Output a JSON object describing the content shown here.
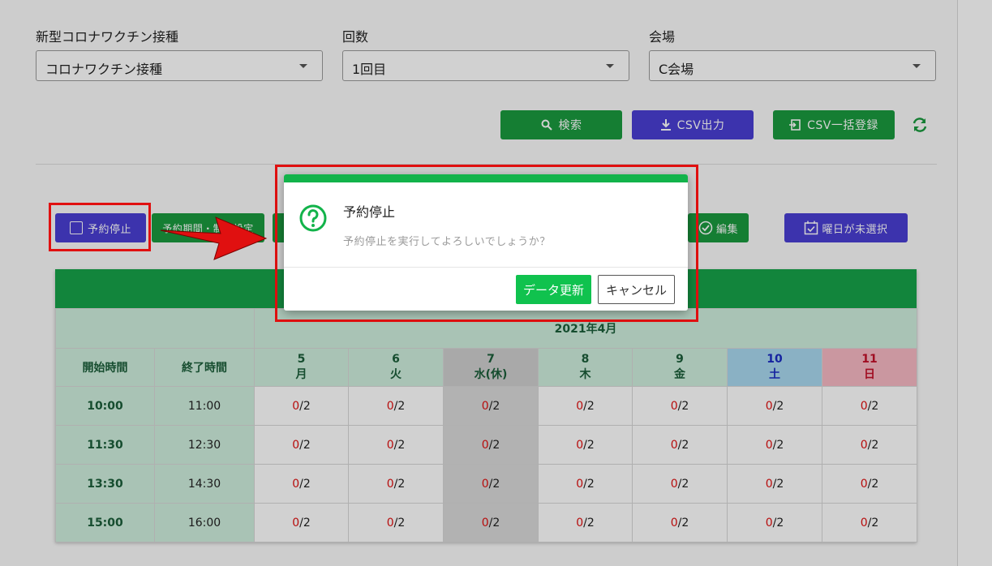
{
  "filters": {
    "vaccine": {
      "label": "新型コロナワクチン接種",
      "value": "コロナワクチン接種"
    },
    "round": {
      "label": "回数",
      "value": "1回目"
    },
    "venue": {
      "label": "会場",
      "value": "C会場"
    }
  },
  "actions": {
    "search": "検索",
    "csv_export": "CSV出力",
    "csv_import": "CSV一括登録"
  },
  "toolbar": {
    "stop_reservation": "予約停止",
    "period_setting": "予約期間・制限設定",
    "edit": "編集",
    "weekday_unselected": "曜日が未選択"
  },
  "table": {
    "month": "2021年4月",
    "start_header": "開始時間",
    "end_header": "終了時間",
    "days": [
      {
        "date": "5",
        "dow": "月"
      },
      {
        "date": "6",
        "dow": "火"
      },
      {
        "date": "7",
        "dow": "水(休)"
      },
      {
        "date": "8",
        "dow": "木"
      },
      {
        "date": "9",
        "dow": "金"
      },
      {
        "date": "10",
        "dow": "土"
      },
      {
        "date": "11",
        "dow": "日"
      }
    ],
    "rows": [
      {
        "start": "10:00",
        "end": "11:00",
        "booked": "0",
        "capacity": "/2"
      },
      {
        "start": "11:30",
        "end": "12:30",
        "booked": "0",
        "capacity": "/2"
      },
      {
        "start": "13:30",
        "end": "14:30",
        "booked": "0",
        "capacity": "/2"
      },
      {
        "start": "15:00",
        "end": "16:00",
        "booked": "0",
        "capacity": "/2"
      }
    ]
  },
  "dialog": {
    "title": "予約停止",
    "message": "予約停止を実行してよろしいでしょうか？",
    "confirm": "データ更新",
    "cancel": "キャンセル"
  },
  "colors": {
    "green": "#1a9a3f",
    "purple": "#4a3fd4",
    "highlight": "#e01010"
  }
}
